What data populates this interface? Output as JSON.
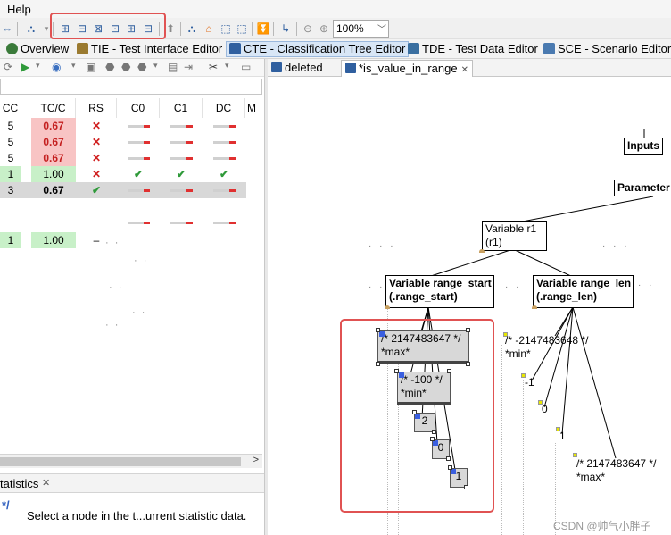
{
  "menu": {
    "help": "Help"
  },
  "toolbar": {
    "zoom_value": "100%"
  },
  "perspectives": [
    {
      "label": "Overview",
      "icon": "overview-icon",
      "color": "#3a7a3a"
    },
    {
      "label": "TIE - Test Interface Editor",
      "icon": "tie-icon",
      "color": "#9a7a30"
    },
    {
      "label": "CTE - Classification Tree Editor",
      "icon": "cte-icon",
      "color": "#2f5f9f"
    },
    {
      "label": "TDE - Test Data Editor",
      "icon": "tde-icon",
      "color": "#3a6fa0"
    },
    {
      "label": "SCE - Scenario Editor",
      "icon": "sce-icon",
      "color": "#4a7ab0"
    }
  ],
  "table": {
    "columns": [
      "CC",
      "TC/C",
      "RS",
      "C0",
      "C1",
      "DC",
      "M"
    ],
    "rows": [
      {
        "cc": "5",
        "tcc": "0.67",
        "rs": "✕",
        "c0": "bar",
        "c1": "bar",
        "dc": "bar"
      },
      {
        "cc": "5",
        "tcc": "0.67",
        "rs": "✕",
        "c0": "bar",
        "c1": "bar",
        "dc": "bar"
      },
      {
        "cc": "5",
        "tcc": "0.67",
        "rs": "✕",
        "c0": "bar",
        "c1": "bar",
        "dc": "bar"
      },
      {
        "cc": "1",
        "tcc": "1.00",
        "rs": "✕",
        "c0": "✔",
        "c1": "✔",
        "dc": "✔"
      },
      {
        "cc": "3",
        "tcc": "0.67",
        "rs": "✔",
        "c0": "bar",
        "c1": "bar",
        "dc": "bar"
      },
      {
        "cc": "1",
        "tcc": "1.00",
        "rs": "–"
      }
    ]
  },
  "statistics": {
    "tab_label": "tatistics",
    "icon_text": "*/",
    "message": "Select a node in the t...urrent statistic data."
  },
  "editor": {
    "tabs": [
      {
        "label": "deleted"
      },
      {
        "label": "*is_value_in_range"
      }
    ]
  },
  "tree": {
    "inputs": "Inputs",
    "parameter": "Parameter",
    "var_r1_line1": "Variable r1",
    "var_r1_line2": "(r1)",
    "var_start_line1": "Variable range_start",
    "var_start_line2": "(.range_start)",
    "var_len_line1": "Variable range_len",
    "var_len_line2": "(.range_len)",
    "start_max_line1": "/* 2147483647 */",
    "start_max_line2": "*max*",
    "start_min_line1": "/* -100 */",
    "start_min_line2": "*min*",
    "start_v2": "2",
    "start_v0": "0",
    "start_v1": "1",
    "len_min_line1": "/* -2147483648 */",
    "len_min_line2": "*min*",
    "len_vm1": "-1",
    "len_v0": "0",
    "len_v1": "1",
    "len_max_line1": "/* 2147483647 */",
    "len_max_line2": "*max*"
  },
  "watermark": "CSDN @帅气小胖子",
  "colors": {
    "highlight": "#e05252",
    "accent": "#2f5f9f"
  }
}
